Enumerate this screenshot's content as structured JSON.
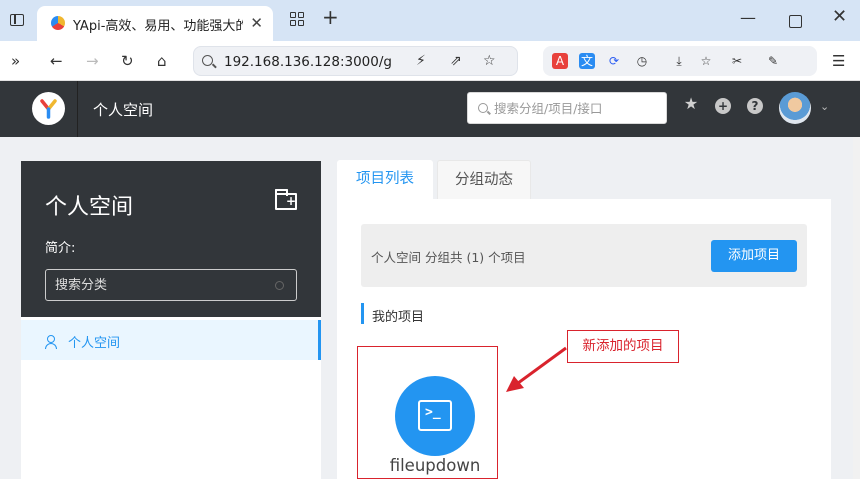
{
  "browser": {
    "tab_title": "YApi-高效、易用、功能强大的可视化接口管理平台",
    "tab_close": "✕",
    "new_tab": "+",
    "min_label": "—",
    "close_label": "✕",
    "url": "192.168.136.128:3000/g"
  },
  "header": {
    "title": "个人空间",
    "search_placeholder": "搜索分组/项目/接口",
    "help_label": "?",
    "add_label": "+",
    "star_label": "★",
    "caret_label": "⌄"
  },
  "group": {
    "name": "个人空间",
    "desc_label": "简介:",
    "search_placeholder": "搜索分类",
    "menu_items": [
      {
        "label": "个人空间"
      }
    ]
  },
  "tabs": [
    {
      "label": "项目列表"
    },
    {
      "label": "分组动态"
    }
  ],
  "projects": {
    "summary": "个人空间 分组共 (1) 个项目",
    "add_button": "添加项目",
    "section_title": "我的项目",
    "items": [
      {
        "name": "fileupdown",
        "icon": "terminal-icon",
        "color": "#2395f1"
      }
    ]
  },
  "annotation": {
    "callout": "新添加的项目",
    "color": "#d9232d"
  },
  "colors": {
    "accent": "#2395f1",
    "header_bg": "#32363a"
  }
}
